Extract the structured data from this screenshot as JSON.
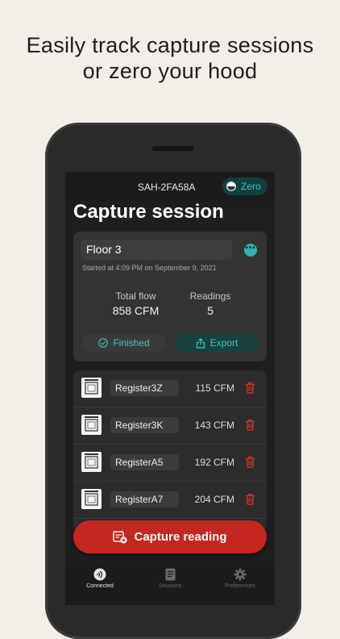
{
  "headline": {
    "line1": "Easily track capture sessions",
    "line2": "or zero your hood"
  },
  "topbar": {
    "device_name": "SAH-2FA58A",
    "zero_label": "Zero"
  },
  "page_title": "Capture session",
  "session": {
    "name": "Floor 3",
    "started": "Started at 4:09 PM on September 9, 2021",
    "total_flow_label": "Total flow",
    "total_flow_value": "858 CFM",
    "readings_label": "Readings",
    "readings_value": "5",
    "finished_label": "Finished",
    "export_label": "Export"
  },
  "readings": [
    {
      "name": "Register3Z",
      "value": "115 CFM"
    },
    {
      "name": "Register3K",
      "value": "143 CFM"
    },
    {
      "name": "RegisterA5",
      "value": "192 CFM"
    },
    {
      "name": "RegisterA7",
      "value": "204 CFM"
    }
  ],
  "capture_button_label": "Capture reading",
  "tabs": [
    {
      "label": "Connected",
      "icon": "connected-icon",
      "active": true
    },
    {
      "label": "Sessions",
      "icon": "sessions-icon",
      "active": false
    },
    {
      "label": "Preferences",
      "icon": "gear-icon",
      "active": false
    }
  ],
  "colors": {
    "accent": "#3cc8bd",
    "danger": "#c4271f",
    "background": "#f2efe9",
    "screen": "#1e1e1e"
  }
}
